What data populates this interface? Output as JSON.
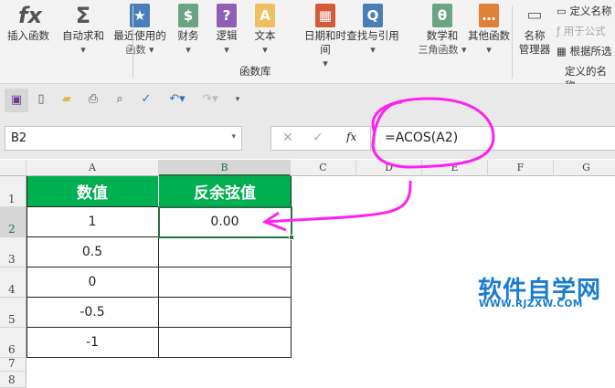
{
  "ribbon": {
    "buttons": [
      {
        "label": "插入函数",
        "label2": "",
        "icon": "fx",
        "color": "#ffffff"
      },
      {
        "label": "自动求和",
        "label2": "▾",
        "icon": "Σ",
        "color": "#ffffff"
      },
      {
        "label": "最近使用的",
        "label2": "函数 ▾",
        "icon": "★",
        "color": "#4a7ebb"
      },
      {
        "label": "财务",
        "label2": "▾",
        "icon": "$",
        "color": "#6aa484"
      },
      {
        "label": "逻辑",
        "label2": "▾",
        "icon": "?",
        "color": "#8e5fb5"
      },
      {
        "label": "文本",
        "label2": "▾",
        "icon": "A",
        "color": "#f0c060"
      },
      {
        "label": "日期和时间",
        "label2": "▾",
        "icon": "▦",
        "color": "#d65a3a"
      },
      {
        "label": "查找与引用",
        "label2": "▾",
        "icon": "Q",
        "color": "#4a7ebb"
      },
      {
        "label": "数学和",
        "label2": "三角函数 ▾",
        "icon": "θ",
        "color": "#6aa484"
      },
      {
        "label": "其他函数",
        "label2": "▾",
        "icon": "…",
        "color": "#e0813a"
      }
    ],
    "group_label": "函数库",
    "name_manager": {
      "line1": "名称",
      "line2": "管理器"
    },
    "define_name": "定义名称",
    "use_in_formula": "用于公式",
    "create_from_selection": "根据所选",
    "group2_label": "定义的名称"
  },
  "name_box": "B2",
  "formula": "=ACOS(A2)",
  "fx_label": "fx",
  "columns": [
    "A",
    "B",
    "C",
    "D",
    "E",
    "F",
    "G"
  ],
  "rows": [
    "1",
    "2",
    "3",
    "4",
    "5",
    "6",
    "7",
    "8"
  ],
  "table": {
    "headers": [
      "数值",
      "反余弦值"
    ],
    "values": [
      "1",
      "0.5",
      "0",
      "-0.5",
      "-1"
    ],
    "results": [
      "0.00",
      "",
      "",
      "",
      ""
    ]
  },
  "watermark": {
    "title": "软件自学网",
    "url": "WWW.RJZXW.COM"
  },
  "colors": {
    "header_green": "#00b050",
    "annotation": "#ff22ee",
    "selection": "#217346"
  }
}
